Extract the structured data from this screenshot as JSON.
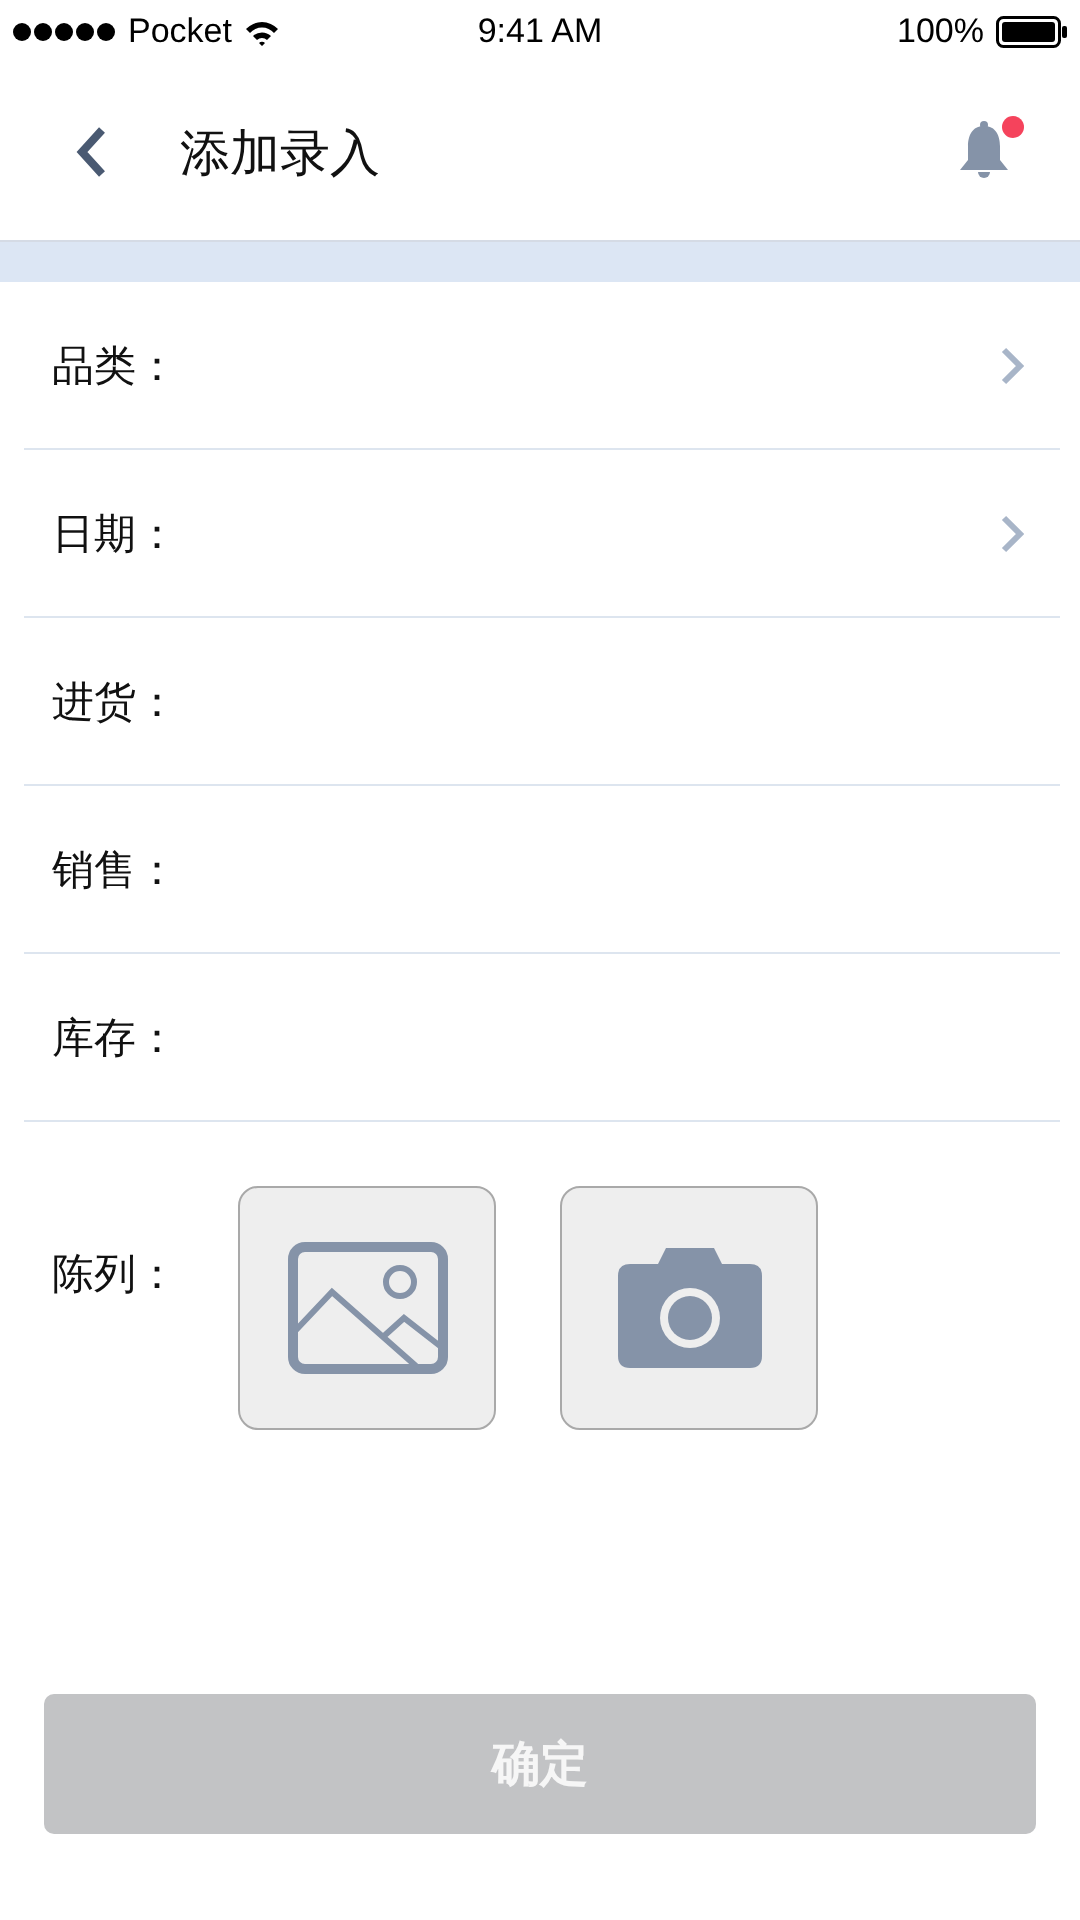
{
  "status_bar": {
    "carrier": "Pocket",
    "time": "9:41 AM",
    "battery": "100%"
  },
  "nav": {
    "title": "添加录入",
    "has_notification": true
  },
  "fields": [
    {
      "label": "品类：",
      "kind": "select"
    },
    {
      "label": "日期：",
      "kind": "select"
    },
    {
      "label": "进货：",
      "kind": "input"
    },
    {
      "label": "销售：",
      "kind": "input"
    },
    {
      "label": "库存：",
      "kind": "input"
    }
  ],
  "display": {
    "label": "陈列：",
    "buttons": [
      {
        "kind": "gallery"
      },
      {
        "kind": "camera"
      }
    ]
  },
  "confirm": {
    "label": "确定",
    "disabled": true
  }
}
